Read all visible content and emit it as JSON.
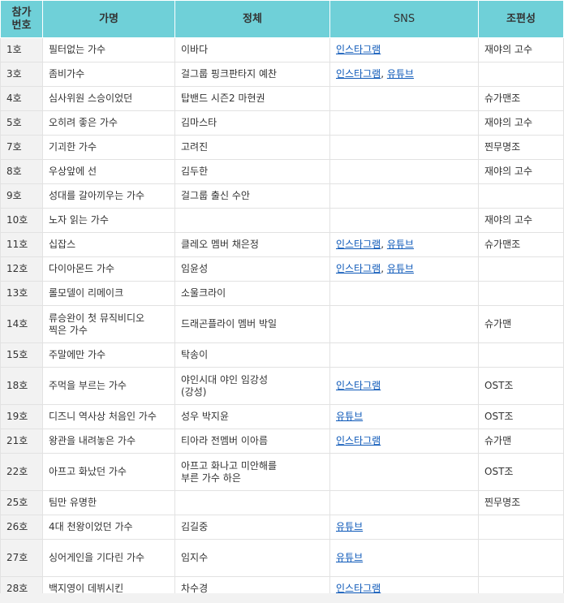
{
  "headers": [
    "참가\n번호",
    "가명",
    "정체",
    "SNS",
    "조편성"
  ],
  "rows": [
    {
      "num": "1호",
      "alias": "필터없는 가수",
      "identity": "이바다",
      "sns": [
        "인스타그램"
      ],
      "group": "재야의 고수"
    },
    {
      "num": "3호",
      "alias": "좀비가수",
      "identity": "걸그룹 핑크판타지 예찬",
      "sns": [
        "인스타그램",
        "유튜브"
      ],
      "group": ""
    },
    {
      "num": "4호",
      "alias": "심사위원 스승이었던",
      "identity": "탑밴드 시즌2 마현권",
      "sns": [],
      "group": "슈가맨조"
    },
    {
      "num": "5호",
      "alias": "오히려 좋은 가수",
      "identity": "김마스타",
      "sns": [],
      "group": "재야의 고수"
    },
    {
      "num": "7호",
      "alias": "기괴한 가수",
      "identity": "고려진",
      "sns": [],
      "group": "찐무명조"
    },
    {
      "num": "8호",
      "alias": "우상앞에 선",
      "identity": "김두한",
      "sns": [],
      "group": "재야의 고수"
    },
    {
      "num": "9호",
      "alias": "성대를 갈아끼우는 가수",
      "identity": "걸그룹 출신 수안",
      "sns": [],
      "group": ""
    },
    {
      "num": "10호",
      "alias": "노자 읽는 가수",
      "identity": "",
      "sns": [],
      "group": "재야의 고수"
    },
    {
      "num": "11호",
      "alias": "십잡스",
      "identity": "클레오 멤버 채은정",
      "sns": [
        "인스타그램",
        "유튜브"
      ],
      "group": "슈가맨조"
    },
    {
      "num": "12호",
      "alias": "다이아몬드 가수",
      "identity": "임윤성",
      "sns": [
        "인스타그램",
        "유튜브"
      ],
      "group": ""
    },
    {
      "num": "13호",
      "alias": "롤모델이 리메이크",
      "identity": "소울크라이",
      "sns": [],
      "group": ""
    },
    {
      "num": "14호",
      "alias": "류승완이 첫 뮤직비디오\n찍은 가수",
      "identity": "드래곤플라이 멤버 박일",
      "sns": [],
      "group": "슈가맨",
      "tall": true
    },
    {
      "num": "15호",
      "alias": "주말에만 가수",
      "identity": "탁송이",
      "sns": [],
      "group": ""
    },
    {
      "num": "18호",
      "alias": "주먹을 부르는 가수",
      "identity": "야인시대 야인 임강성\n(강성)",
      "sns": [
        "인스타그램"
      ],
      "group": "OST조",
      "tall": true
    },
    {
      "num": "19호",
      "alias": "디즈니 역사상 처음인 가수",
      "identity": "성우 박지윤",
      "sns": [
        "유튜브"
      ],
      "group": "OST조"
    },
    {
      "num": "21호",
      "alias": "왕관을 내려놓은 가수",
      "identity": "티아라 전멤버 이아름",
      "sns": [
        "인스타그램"
      ],
      "group": "슈가맨"
    },
    {
      "num": "22호",
      "alias": "아프고 화났던 가수",
      "identity": " 아프고 화나고 미안해를\n부른 가수 하은",
      "sns": [],
      "group": "OST조",
      "tall": true
    },
    {
      "num": "25호",
      "alias": "팀만 유명한",
      "identity": "",
      "sns": [],
      "group": "찐무명조"
    },
    {
      "num": "26호",
      "alias": "4대 천왕이었던 가수",
      "identity": "김길중",
      "sns": [
        "유튜브"
      ],
      "group": ""
    },
    {
      "num": "27호",
      "alias": "싱어게인을 기다린 가수",
      "identity": "임지수",
      "sns": [
        "유튜브"
      ],
      "group": "",
      "tall": true
    },
    {
      "num": "28호",
      "alias": "백지영이 데뷔시킨",
      "identity": "차수경",
      "sns": [
        "인스타그램"
      ],
      "group": ""
    }
  ],
  "colors": {
    "header_bg": "#6fd0d8",
    "link": "#0b57b8",
    "num_bg": "#f2f2f2",
    "border": "#e2e2e2"
  }
}
